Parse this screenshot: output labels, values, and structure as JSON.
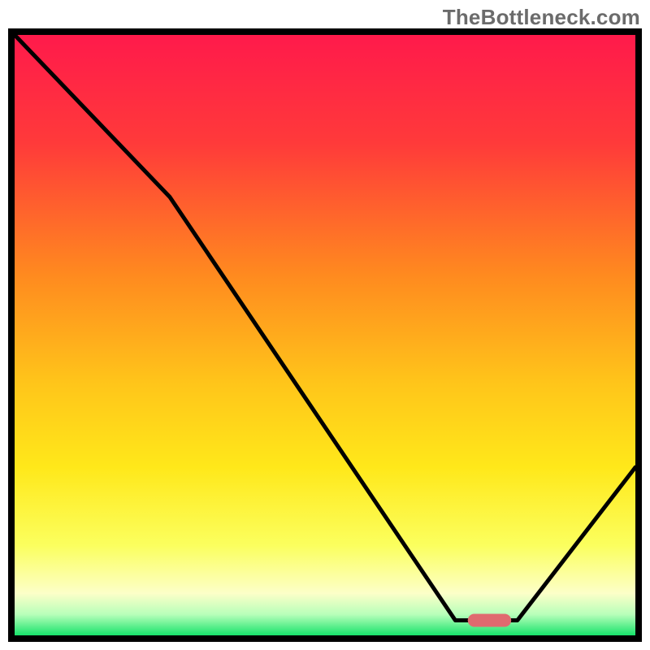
{
  "watermark": "TheBottleneck.com",
  "chart_data": {
    "type": "line",
    "title": "",
    "xlabel": "",
    "ylabel": "",
    "xlim": [
      0,
      100
    ],
    "ylim": [
      0,
      100
    ],
    "x": [
      0,
      25,
      71,
      76,
      81,
      100
    ],
    "values": [
      100,
      73,
      2.5,
      2.5,
      2.5,
      28
    ],
    "marker": {
      "x_start": 73,
      "x_end": 80,
      "y": 2.5
    },
    "background_gradient": {
      "stops": [
        {
          "pos": 0.0,
          "color": "#ff1a4b"
        },
        {
          "pos": 0.18,
          "color": "#ff3a3a"
        },
        {
          "pos": 0.4,
          "color": "#ff8a1f"
        },
        {
          "pos": 0.58,
          "color": "#ffc51a"
        },
        {
          "pos": 0.72,
          "color": "#ffe81a"
        },
        {
          "pos": 0.85,
          "color": "#fbff5e"
        },
        {
          "pos": 0.93,
          "color": "#fcffc8"
        },
        {
          "pos": 0.965,
          "color": "#b8ffba"
        },
        {
          "pos": 1.0,
          "color": "#17e36b"
        }
      ]
    },
    "line_color": "#000000",
    "marker_color": "#e06a6f",
    "frame_color": "#000000"
  }
}
